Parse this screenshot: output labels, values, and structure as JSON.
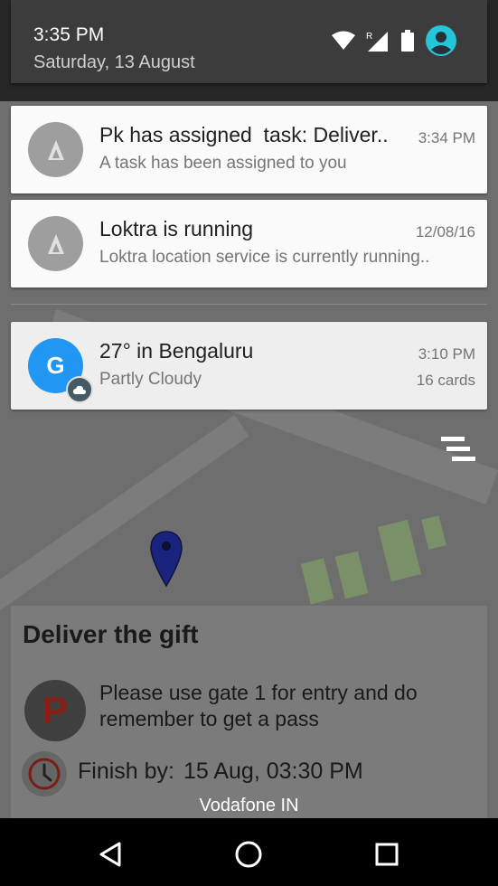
{
  "status_bar": {
    "time": "3:35 PM",
    "date": "Saturday, 13 August",
    "icons": [
      "wifi-icon",
      "signal-roaming-icon",
      "battery-icon",
      "user-avatar-icon"
    ],
    "roaming_label": "R"
  },
  "notifications": [
    {
      "app": "Loktra",
      "icon": "loktra-icon",
      "title": "Pk has assigned  task: Deliver..",
      "text": "A task has been assigned to you",
      "time": "3:34 PM"
    },
    {
      "app": "Loktra",
      "icon": "loktra-icon",
      "title": "Loktra is running",
      "text": "Loktra location service is currently running..",
      "time": "12/08/16"
    }
  ],
  "google_card": {
    "icon_letter": "G",
    "icon": "google-icon",
    "badge_icon": "cloud-icon",
    "title": "27° in Bengaluru",
    "text": "Partly Cloudy",
    "time": "3:10 PM",
    "count": "16 cards"
  },
  "shade": {
    "clear_all_icon": "clear-all-icon",
    "carrier": "Vodafone IN"
  },
  "background_app": {
    "task_title": "Deliver the gift",
    "parking_letter": "P",
    "note": "Please use gate 1 for entry and do remember to get a pass",
    "finish_label": "Finish by:",
    "finish_value": "15 Aug, 03:30 PM",
    "pin_icon": "map-pin-icon"
  },
  "navbar": {
    "buttons": [
      "back-icon",
      "home-icon",
      "recents-icon"
    ]
  },
  "colors": {
    "accent_google": "#2196f3",
    "avatar": "#26c6da",
    "pin": "#1a237e"
  }
}
